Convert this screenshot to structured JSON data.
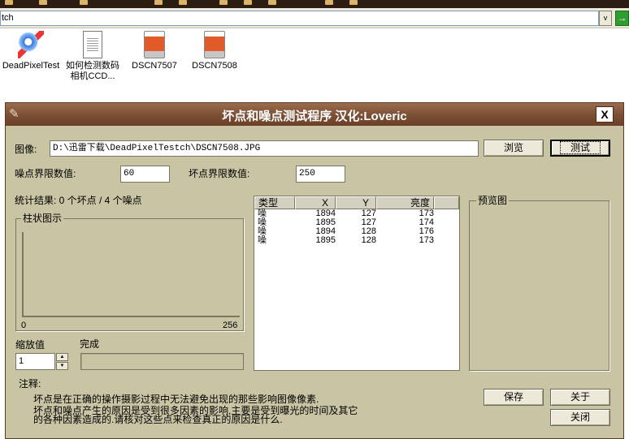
{
  "explorer": {
    "address_text": "tch",
    "dropdown_glyph": "v",
    "go_glyph": "→",
    "files": [
      {
        "label": "DeadPixelTest",
        "icon": "dead-pixel-app-icon"
      },
      {
        "label": "如何检测数码相机CCD...",
        "icon": "text-document-icon"
      },
      {
        "label": "DSCN7507",
        "icon": "jpeg-image-icon"
      },
      {
        "label": "DSCN7508",
        "icon": "jpeg-image-icon"
      }
    ]
  },
  "dialog": {
    "title": "坏点和噪点测试程序  汉化:Loveric",
    "close_glyph": "X",
    "image_label": "图像:",
    "image_path": "D:\\迅雷下载\\DeadPixelTestch\\DSCN7508.JPG",
    "browse_label": "浏览",
    "test_label": "测试",
    "noise_threshold_label": "噪点界限数值:",
    "noise_threshold_value": "60",
    "dead_threshold_label": "坏点界限数值:",
    "dead_threshold_value": "250",
    "stats_text": "统计结果:  0 个坏点 / 4 个噪点",
    "histogram_title": "柱状图示",
    "histogram_min": "0",
    "histogram_max": "256",
    "preview_title": "预览图",
    "zoom_label": "缩放值",
    "zoom_value": "1",
    "progress_label": "完成",
    "progress_fraction": 0,
    "note_title": "注释:",
    "note_line1": "坏点是在正确的操作摄影过程中无法避免出现的那些影响图像像素.",
    "note_line2": "坏点和噪点产生的原因是受到很多因素的影响,主要是受到曝光的时间及其它",
    "note_line3": "的各种因素造成的.请核对这些点来检查真正的原因是什么.",
    "save_label": "保存",
    "about_label": "关于",
    "close_label": "关闭",
    "table": {
      "headers": [
        "类型",
        "X",
        "Y",
        "亮度"
      ],
      "rows": [
        {
          "type": "噪",
          "x": "1894",
          "y": "127",
          "lum": "173"
        },
        {
          "type": "噪",
          "x": "1895",
          "y": "127",
          "lum": "174"
        },
        {
          "type": "噪",
          "x": "1894",
          "y": "128",
          "lum": "176"
        },
        {
          "type": "噪",
          "x": "1895",
          "y": "128",
          "lum": "173"
        }
      ]
    }
  },
  "colors": {
    "dialog_bg": "#c8c4a4",
    "titlebar": "#7d5136"
  }
}
